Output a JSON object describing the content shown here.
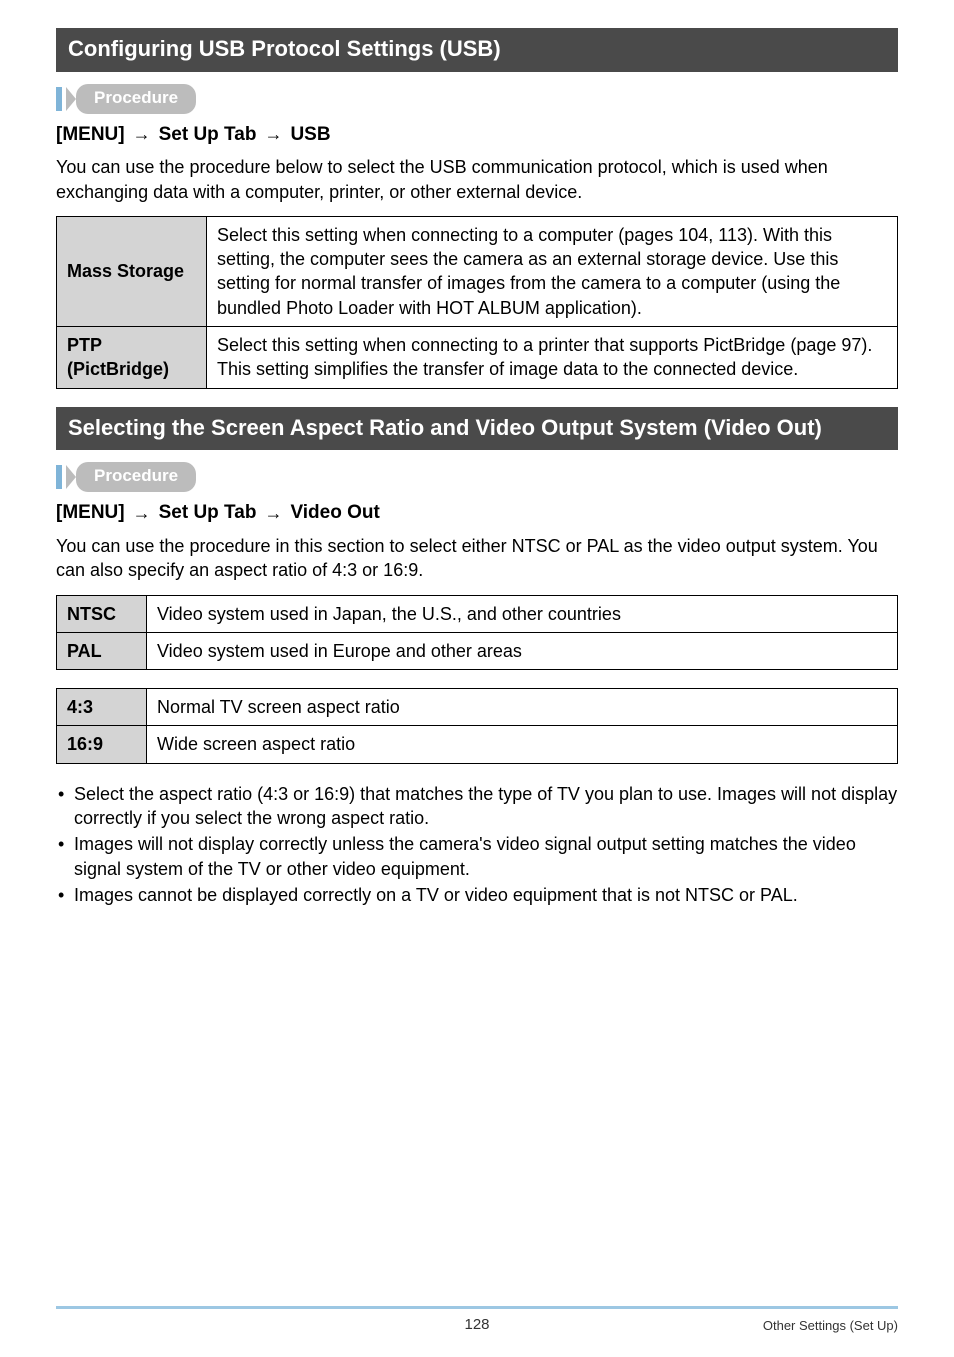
{
  "section1": {
    "title": "Configuring USB Protocol Settings (USB)",
    "procedure_label": "Procedure",
    "menu_path": [
      "[MENU]",
      "Set Up Tab",
      "USB"
    ],
    "intro": "You can use the procedure below to select the USB communication protocol, which is used when exchanging data with a computer, printer, or other external device.",
    "options": [
      {
        "key": "Mass Storage",
        "desc": "Select this setting when connecting to a computer (pages 104, 113). With this setting, the computer sees the camera as an external storage device. Use this setting for normal transfer of images from the camera to a computer (using the bundled Photo Loader with HOT ALBUM application)."
      },
      {
        "key": "PTP (PictBridge)",
        "desc": "Select this setting when connecting to a printer that supports PictBridge (page 97). This setting simplifies the transfer of image data to the connected device."
      }
    ]
  },
  "section2": {
    "title": "Selecting the Screen Aspect Ratio and Video Output System (Video Out)",
    "procedure_label": "Procedure",
    "menu_path": [
      "[MENU]",
      "Set Up Tab",
      "Video Out"
    ],
    "intro": "You can use the procedure in this section to select either NTSC or PAL as the video output system. You can also specify an aspect ratio of 4:3 or 16:9.",
    "video_systems": [
      {
        "key": "NTSC",
        "desc": "Video system used in Japan, the U.S., and other countries"
      },
      {
        "key": "PAL",
        "desc": "Video system used in Europe and other areas"
      }
    ],
    "aspect_ratios": [
      {
        "key": "4:3",
        "desc": "Normal TV screen aspect ratio"
      },
      {
        "key": "16:9",
        "desc": "Wide screen aspect ratio"
      }
    ],
    "bullets": [
      "Select the aspect ratio (4:3 or 16:9) that matches the type of TV you plan to use. Images will not display correctly if you select the wrong aspect ratio.",
      "Images will not display correctly unless the camera's video signal output setting matches the video signal system of the TV or other video equipment.",
      "Images cannot be displayed correctly on a TV or video equipment that is not NTSC or PAL."
    ]
  },
  "footer": {
    "page_number": "128",
    "section_label": "Other Settings (Set Up)"
  },
  "glyphs": {
    "arrow": "→"
  }
}
